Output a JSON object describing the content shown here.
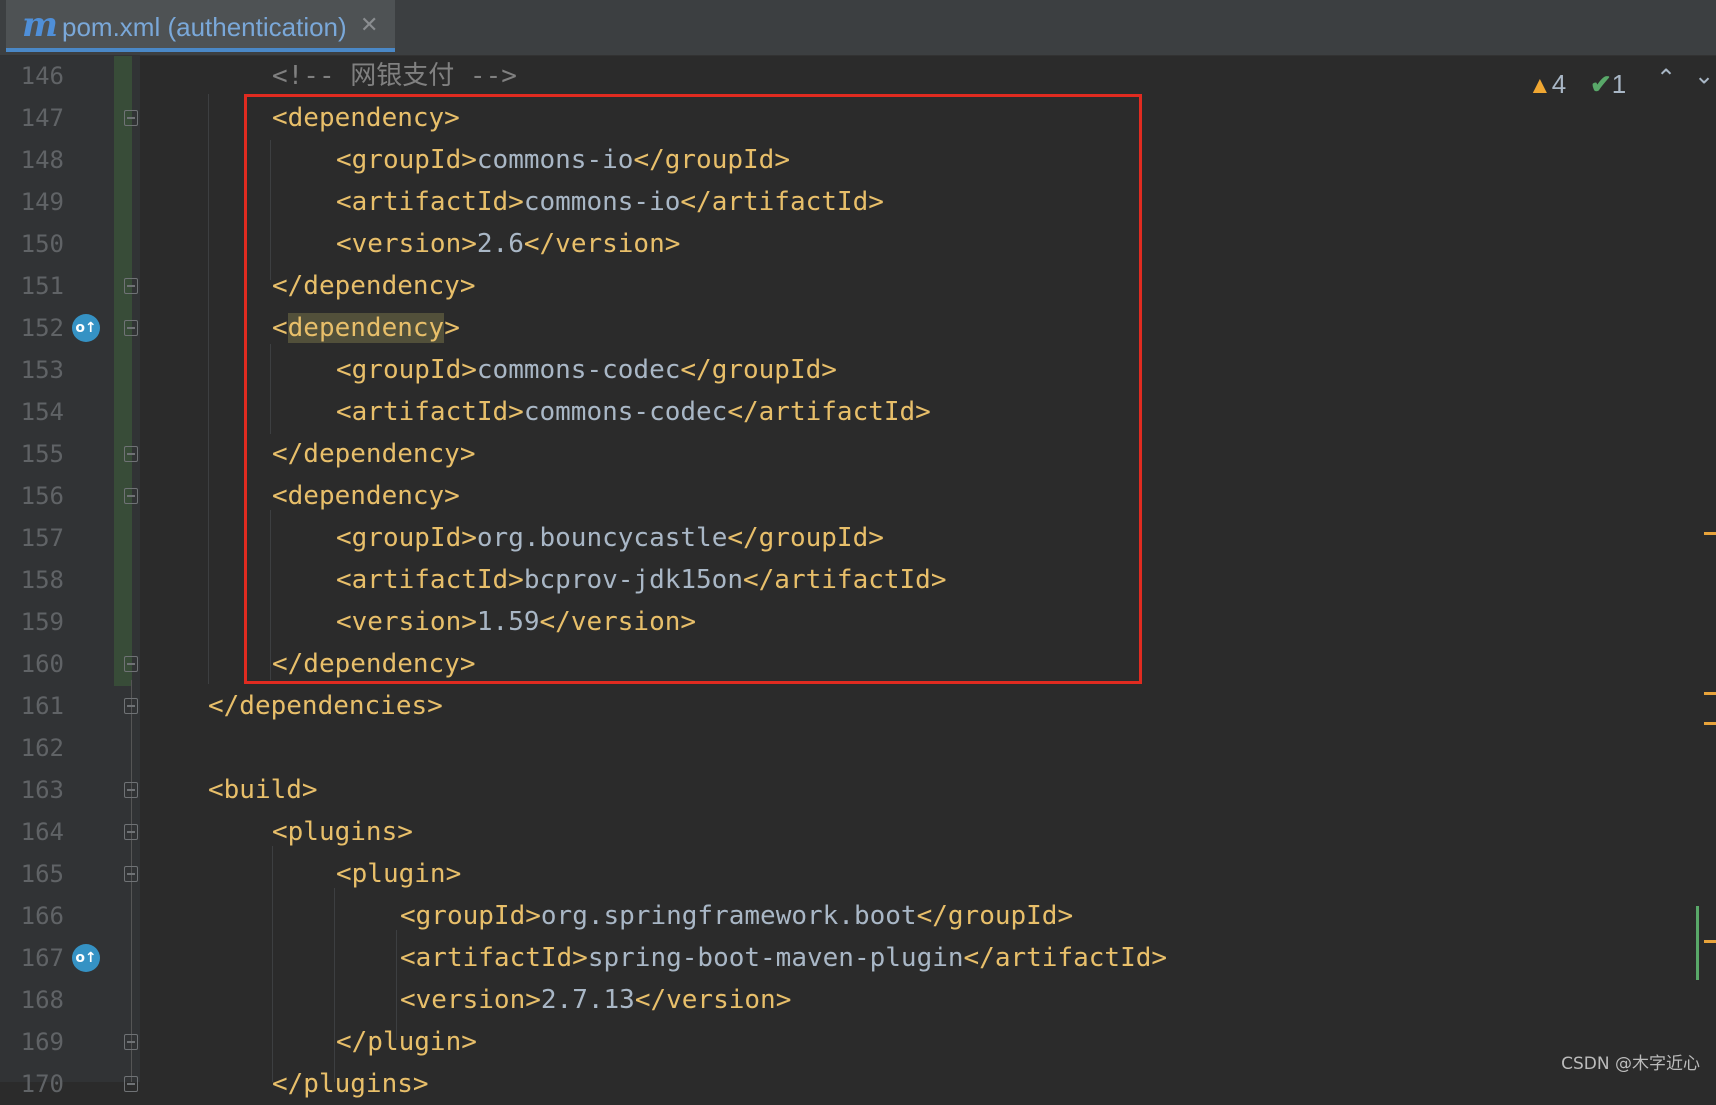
{
  "tab": {
    "logo": "m",
    "label": "pom.xml (authentication)",
    "close": "✕"
  },
  "inspection": {
    "warnings": "4",
    "checks": "1",
    "warning_icon": "warning-triangle-icon",
    "check_icon": "double-check-icon"
  },
  "gutter_icon_glyph": "o↑",
  "watermark": "CSDN @木字近心",
  "lines": [
    {
      "num": "146",
      "indent": 2,
      "parts": [
        {
          "t": "c",
          "s": "<!-- 网银支付 -->"
        }
      ]
    },
    {
      "num": "147",
      "indent": 2,
      "fold": true,
      "parts": [
        {
          "t": "tag",
          "s": "<dependency>"
        }
      ]
    },
    {
      "num": "148",
      "indent": 3,
      "parts": [
        {
          "t": "tag",
          "s": "<groupId>"
        },
        {
          "t": "v",
          "s": "commons-io"
        },
        {
          "t": "tag",
          "s": "</groupId>"
        }
      ]
    },
    {
      "num": "149",
      "indent": 3,
      "parts": [
        {
          "t": "tag",
          "s": "<artifactId>"
        },
        {
          "t": "v",
          "s": "commons-io"
        },
        {
          "t": "tag",
          "s": "</artifactId>"
        }
      ]
    },
    {
      "num": "150",
      "indent": 3,
      "parts": [
        {
          "t": "tag",
          "s": "<version>"
        },
        {
          "t": "v",
          "s": "2.6"
        },
        {
          "t": "tag",
          "s": "</version>"
        }
      ]
    },
    {
      "num": "151",
      "indent": 2,
      "fold": true,
      "parts": [
        {
          "t": "tag",
          "s": "</dependency>"
        }
      ]
    },
    {
      "num": "152",
      "indent": 2,
      "fold": true,
      "icon": true,
      "parts": [
        {
          "t": "tag",
          "s": "<"
        },
        {
          "t": "hl",
          "s": "dependency"
        },
        {
          "t": "tag",
          "s": ">"
        }
      ]
    },
    {
      "num": "153",
      "indent": 3,
      "parts": [
        {
          "t": "tag",
          "s": "<groupId>"
        },
        {
          "t": "v",
          "s": "commons-codec"
        },
        {
          "t": "tag",
          "s": "</groupId>"
        }
      ]
    },
    {
      "num": "154",
      "indent": 3,
      "parts": [
        {
          "t": "tag",
          "s": "<artifactId>"
        },
        {
          "t": "v",
          "s": "commons-codec"
        },
        {
          "t": "tag",
          "s": "</artifactId>"
        }
      ]
    },
    {
      "num": "155",
      "indent": 2,
      "fold": true,
      "parts": [
        {
          "t": "tag",
          "s": "</dependency>"
        }
      ]
    },
    {
      "num": "156",
      "indent": 2,
      "fold": true,
      "parts": [
        {
          "t": "tag",
          "s": "<dependency>"
        }
      ]
    },
    {
      "num": "157",
      "indent": 3,
      "parts": [
        {
          "t": "tag",
          "s": "<groupId>"
        },
        {
          "t": "v",
          "s": "org.bouncycastle"
        },
        {
          "t": "tag",
          "s": "</groupId>"
        }
      ]
    },
    {
      "num": "158",
      "indent": 3,
      "parts": [
        {
          "t": "tag",
          "s": "<artifactId>"
        },
        {
          "t": "v",
          "s": "bcprov-jdk15on"
        },
        {
          "t": "tag",
          "s": "</artifactId>"
        }
      ]
    },
    {
      "num": "159",
      "indent": 3,
      "parts": [
        {
          "t": "tag",
          "s": "<version>"
        },
        {
          "t": "v",
          "s": "1.59"
        },
        {
          "t": "tag",
          "s": "</version>"
        }
      ]
    },
    {
      "num": "160",
      "indent": 2,
      "fold": true,
      "parts": [
        {
          "t": "tag",
          "s": "</dependency>"
        }
      ]
    },
    {
      "num": "161",
      "indent": 1,
      "fold": true,
      "parts": [
        {
          "t": "tag",
          "s": "</dependencies>"
        }
      ]
    },
    {
      "num": "162",
      "indent": 1,
      "parts": []
    },
    {
      "num": "163",
      "indent": 1,
      "fold": true,
      "parts": [
        {
          "t": "tag",
          "s": "<build>"
        }
      ]
    },
    {
      "num": "164",
      "indent": 2,
      "fold": true,
      "parts": [
        {
          "t": "tag",
          "s": "<plugins>"
        }
      ]
    },
    {
      "num": "165",
      "indent": 3,
      "fold": true,
      "parts": [
        {
          "t": "tag",
          "s": "<plugin>"
        }
      ]
    },
    {
      "num": "166",
      "indent": 4,
      "parts": [
        {
          "t": "tag",
          "s": "<groupId>"
        },
        {
          "t": "v",
          "s": "org.springframework.boot"
        },
        {
          "t": "tag",
          "s": "</groupId>"
        }
      ]
    },
    {
      "num": "167",
      "indent": 4,
      "icon": true,
      "parts": [
        {
          "t": "tag",
          "s": "<artifactId>"
        },
        {
          "t": "v",
          "s": "spring-boot-maven-plugin"
        },
        {
          "t": "tag",
          "s": "</artifactId>"
        }
      ]
    },
    {
      "num": "168",
      "indent": 4,
      "parts": [
        {
          "t": "tag",
          "s": "<version>"
        },
        {
          "t": "v",
          "s": "2.7.13"
        },
        {
          "t": "tag",
          "s": "</version>"
        }
      ]
    },
    {
      "num": "169",
      "indent": 3,
      "fold": true,
      "parts": [
        {
          "t": "tag",
          "s": "</plugin>"
        }
      ]
    },
    {
      "num": "170",
      "indent": 2,
      "fold": true,
      "parts": [
        {
          "t": "tag",
          "s": "</plugins>"
        }
      ]
    }
  ]
}
